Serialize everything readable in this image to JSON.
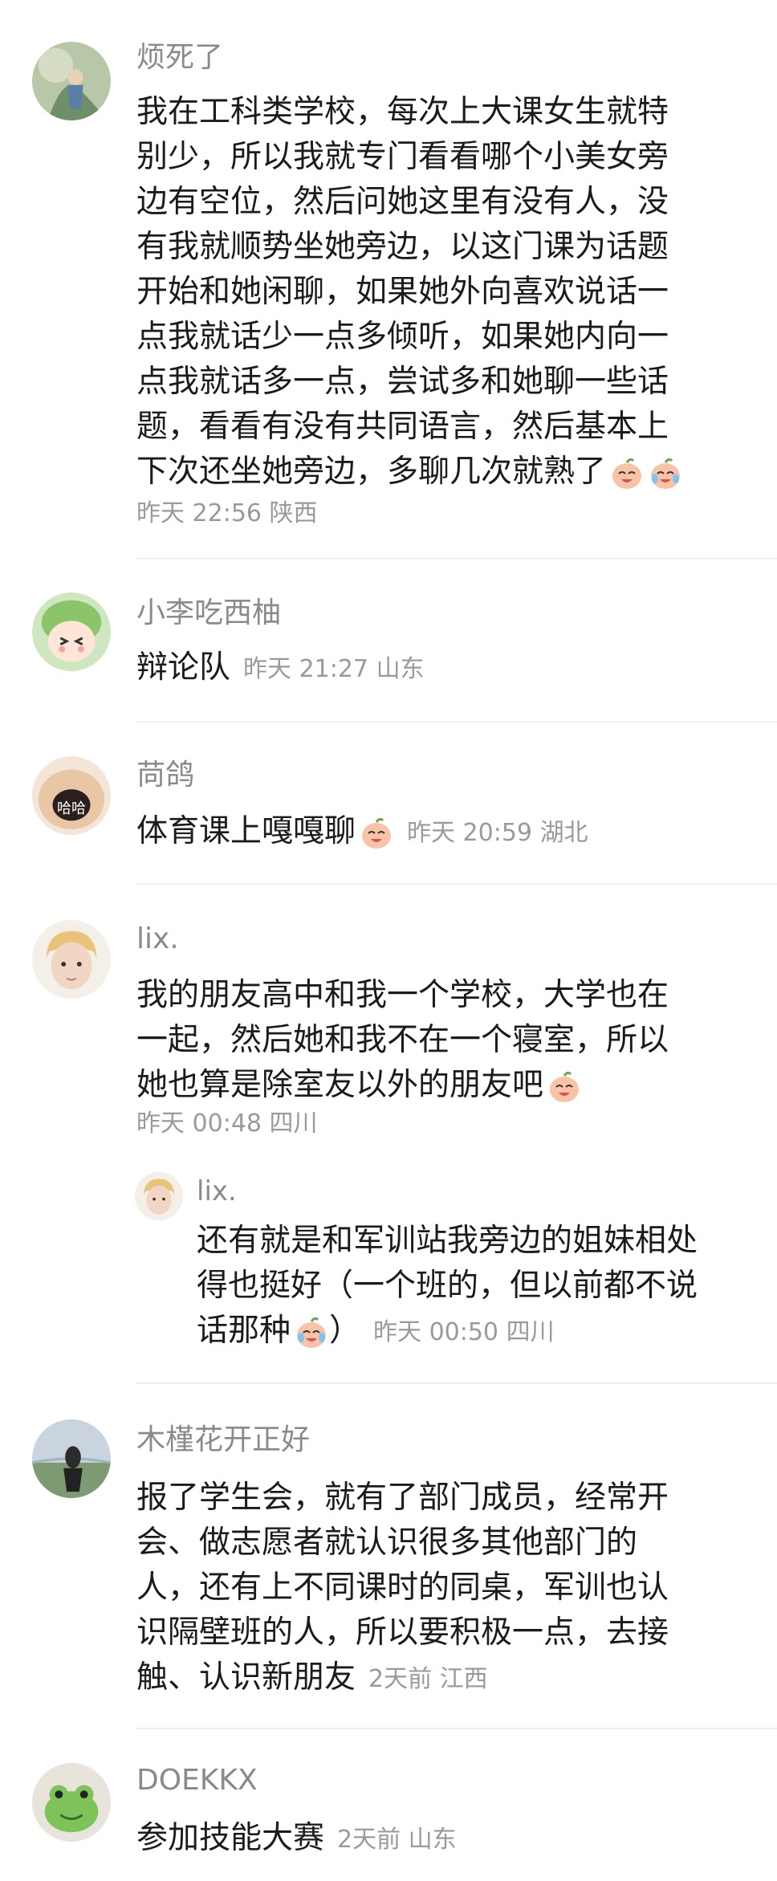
{
  "comments": [
    {
      "username": "烦死了",
      "lines": [
        "我在工科类学校，每次上大课女生就特",
        "别少，所以我就专门看看哪个小美女旁",
        "边有空位，然后问她这里有没有人，没",
        "有我就顺势坐她旁边，以这门课为话题",
        "开始和她闲聊，如果她外向喜欢说话一",
        "点我就话少一点多倾听，如果她内向一",
        "点我就话多一点，尝试多和她聊一些话",
        "题，看看有没有共同语言，然后基本上",
        "下次还坐她旁边，多聊几次就熟了"
      ],
      "time": "昨天 22:56",
      "location": "陕西",
      "emoji_icons": [
        "peach-laugh-emoji-icon",
        "peach-cry-laugh-emoji-icon"
      ]
    },
    {
      "username": "小李吃西柚",
      "text": "辩论队",
      "time": "昨天 21:27",
      "location": "山东"
    },
    {
      "username": "苘鸽",
      "text": "体育课上嘎嘎聊",
      "time": "昨天 20:59",
      "location": "湖北",
      "emoji_icons": [
        "peach-laugh-emoji-icon"
      ],
      "avatar_text": "哈哈"
    },
    {
      "username": "lix.",
      "lines": [
        "我的朋友高中和我一个学校，大学也在",
        "一起，然后她和我不在一个寝室，所以",
        "她也算是除室友以外的朋友吧"
      ],
      "time": "昨天 00:48",
      "location": "四川",
      "emoji_icons": [
        "peach-laugh-emoji-icon"
      ],
      "reply": {
        "username": "lix.",
        "lines": [
          "还有就是和军训站我旁边的姐妹相处",
          "得也挺好（一个班的，但以前都不说",
          "话那种"
        ],
        "line3_suffix": "）",
        "time": "昨天 00:50",
        "location": "四川",
        "emoji_icons": [
          "peach-cry-laugh-emoji-icon"
        ]
      }
    },
    {
      "username": "木槿花开正好",
      "lines": [
        "报了学生会，就有了部门成员，经常开",
        "会、做志愿者就认识很多其他部门的",
        "人，还有上不同课时的同桌，军训也认",
        "识隔壁班的人，所以要积极一点，去接",
        "触、认识新朋友"
      ],
      "time": "2天前",
      "location": "江西"
    },
    {
      "username": "DOEKKX",
      "text": "参加技能大赛",
      "time": "2天前",
      "location": "山东"
    }
  ],
  "colors": {
    "username": "#8a8a8a",
    "body": "#1b1b1b",
    "meta": "#9a9a9a",
    "divider": "#efefef"
  }
}
